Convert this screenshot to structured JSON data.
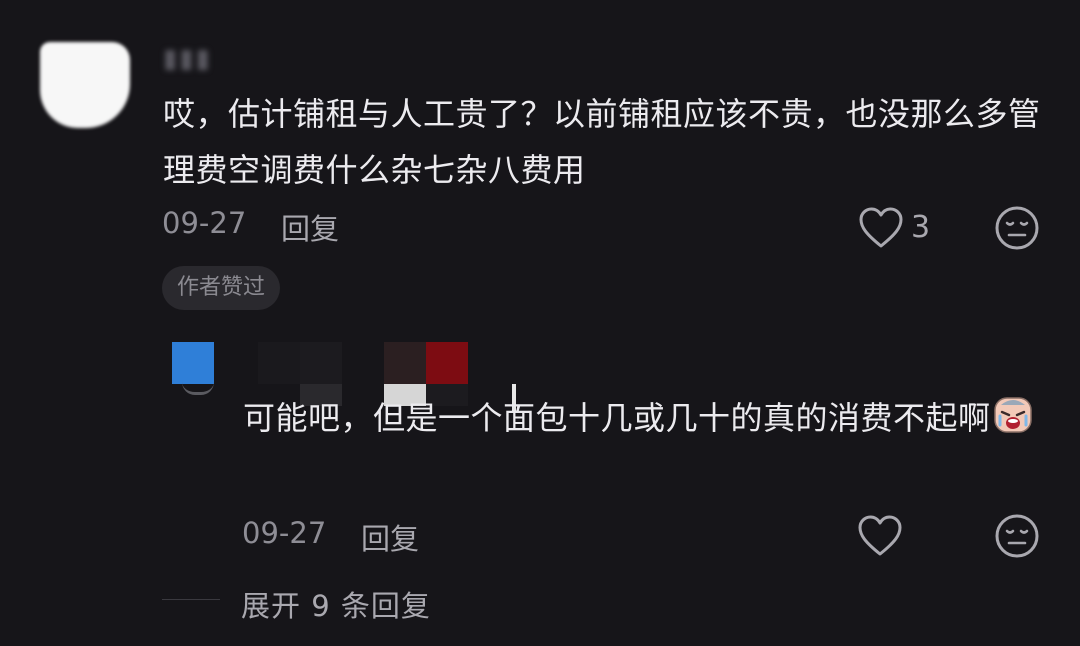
{
  "comment": {
    "text": "哎，估计铺租与人工贵了？以前铺租应该不贵，也没那么多管理费空调费什么杂七杂八费用",
    "date": "09-27",
    "reply_label": "回复",
    "likes": "3",
    "badge": "作者赞过"
  },
  "reply": {
    "text": "可能吧，但是一个面包十几或几十的真的消费不起啊",
    "date": "09-27",
    "reply_label": "回复"
  },
  "expand_label": "展开 9 条回复",
  "colors": {
    "background": "#161519",
    "text": "#ecebef",
    "meta": "#8e8d95",
    "avatar_blue": "#2f7fd8"
  },
  "icons": [
    "heart-outline-icon",
    "expressionless-face-icon",
    "crying-face-emoji"
  ]
}
